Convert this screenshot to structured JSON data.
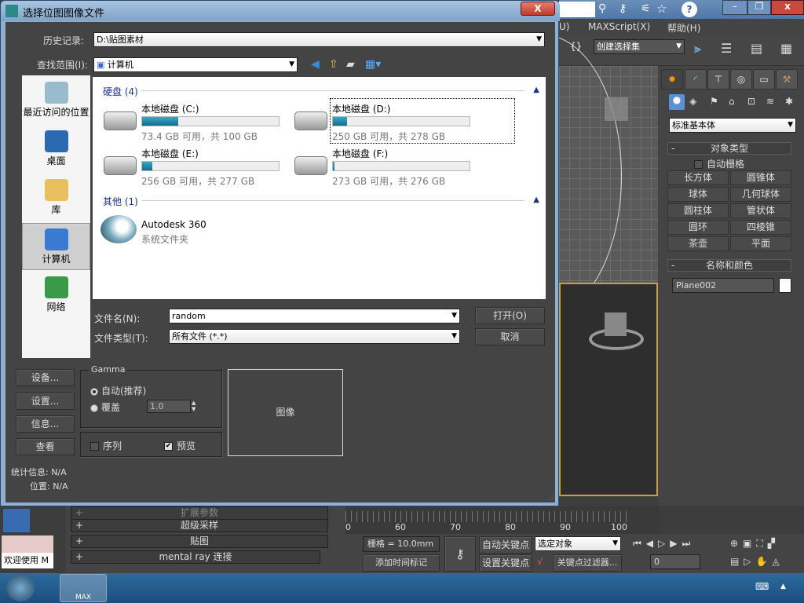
{
  "max": {
    "menu": [
      "U)",
      "MAXScript(X)",
      "帮助(H)"
    ],
    "selection_set": "创建选择集",
    "primitive_type": "标准基本体",
    "object_type_title": "对象类型",
    "autogrid": "自动栅格",
    "object_buttons": [
      "长方体",
      "圆锥体",
      "球体",
      "几何球体",
      "圆柱体",
      "管状体",
      "圆环",
      "四棱锥",
      "茶壶",
      "平面"
    ],
    "name_color_title": "名称和颜色",
    "object_name": "Plane002",
    "object_color": "#ffffff",
    "rollouts": [
      "扩展参数",
      "超级采样",
      "贴图",
      "mental ray 连接"
    ],
    "timeline_ticks": [
      "0",
      "60",
      "70",
      "80",
      "90",
      "100"
    ],
    "grid": "栅格 = 10.0mm",
    "add_time_tag": "添加时间标记",
    "auto_key": "自动关键点",
    "set_key": "设置关键点",
    "key_mode": "选定对象",
    "key_filters": "关键点过滤器...",
    "frame": "0",
    "welcome": "欢迎使用 M",
    "taskbar_app": "MAX"
  },
  "dialog": {
    "title": "选择位图图像文件",
    "close": "X",
    "history_label": "历史记录:",
    "history_value": "D:\\贴图素材",
    "lookin_label": "查找范围(I):",
    "lookin_value": "计算机",
    "places": [
      {
        "label": "最近访问的位置",
        "icon": "recent-places-icon"
      },
      {
        "label": "桌面",
        "icon": "desktop-icon"
      },
      {
        "label": "库",
        "icon": "library-icon"
      },
      {
        "label": "计算机",
        "icon": "computer-icon",
        "selected": true
      },
      {
        "label": "网络",
        "icon": "network-icon"
      }
    ],
    "group_drives": "硬盘 (4)",
    "group_other": "其他 (1)",
    "drives": [
      {
        "name": "本地磁盘 (C:)",
        "free": "73.4 GB 可用，共 100 GB",
        "used_percent": 26.6
      },
      {
        "name": "本地磁盘 (D:)",
        "free": "250 GB 可用，共 278 GB",
        "used_percent": 10.1,
        "focused": true
      },
      {
        "name": "本地磁盘 (E:)",
        "free": "256 GB 可用，共 277 GB",
        "used_percent": 7.6
      },
      {
        "name": "本地磁盘 (F:)",
        "free": "273 GB 可用，共 276 GB",
        "used_percent": 1.1
      }
    ],
    "other_item": {
      "name": "Autodesk 360",
      "type": "系统文件夹"
    },
    "filename_label": "文件名(N):",
    "filename_value": "random",
    "filetype_label": "文件类型(T):",
    "filetype_value": "所有文件 (*.*)",
    "open": "打开(O)",
    "cancel": "取消",
    "devices": "设备...",
    "setup": "设置...",
    "info": "信息...",
    "view": "查看",
    "gamma_title": "Gamma",
    "gamma_auto": "自动(推荐)",
    "gamma_override": "覆盖",
    "gamma_value": "1.0",
    "sequence": "序列",
    "preview": "预览",
    "preview_checked": true,
    "image_placeholder": "图像",
    "stats": "统计信息: N/A",
    "location": "位置: N/A"
  }
}
